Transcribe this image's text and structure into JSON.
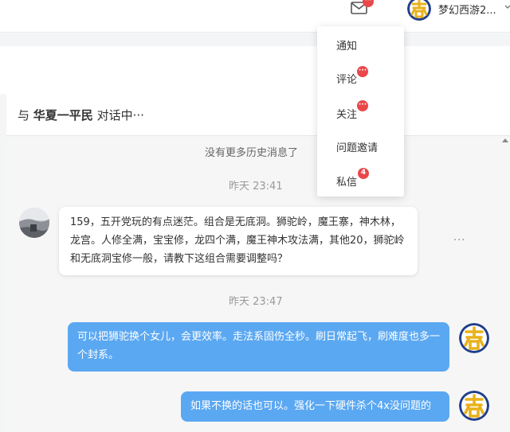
{
  "header": {
    "mail_badge": "···",
    "username": "梦幻西游2..."
  },
  "dropdown": {
    "items": [
      {
        "label": "通知",
        "badge": ""
      },
      {
        "label": "评论",
        "badge": "···"
      },
      {
        "label": "关注",
        "badge": "···"
      },
      {
        "label": "问题邀请",
        "badge": ""
      },
      {
        "label": "私信",
        "badge": "4"
      }
    ]
  },
  "conversation": {
    "title_prefix": "与",
    "partner": "华夏一平民",
    "title_suffix": "对话中···",
    "no_more_history": "没有更多历史消息了",
    "more_icon": "···",
    "messages": [
      {
        "time": "昨天 23:41",
        "direction": "incoming",
        "text": "159，五开党玩的有点迷茫。组合是无底洞。狮驼岭，魔王寨，神木林，龙宫。人修全满，宝宝修，龙四个满，魔王神木攻法满，其他20，狮驼岭和无底洞宝修一般，请教下这组合需要调整吗？"
      },
      {
        "time": "昨天 23:47",
        "direction": "outgoing",
        "text": "可以把狮驼换个女儿，会更效率。走法系固伤全秒。刷日常起飞，刷难度也多一个封系。"
      },
      {
        "time": "",
        "direction": "outgoing",
        "text": "如果不换的话也可以。强化一下硬件杀个4x没问题的"
      }
    ]
  },
  "colors": {
    "outgoing_bubble": "#5ba8f2",
    "badge": "#e9474a",
    "avatar_gold": "#e8b21c",
    "avatar_blue": "#1f3f8c"
  },
  "icons": [
    "mail-icon",
    "caret-down-icon",
    "more-options-icon",
    "user-avatar",
    "partner-avatar"
  ]
}
